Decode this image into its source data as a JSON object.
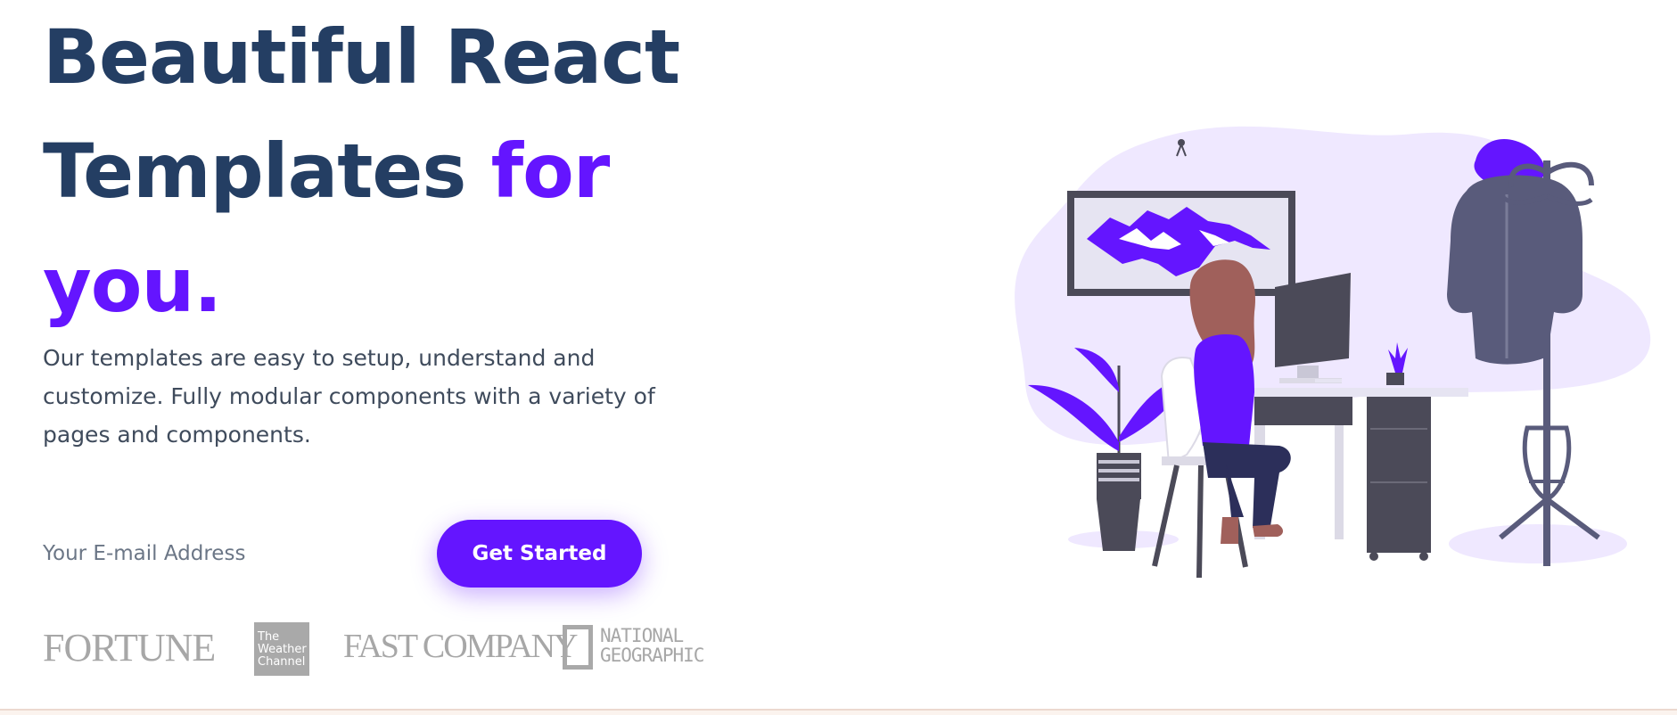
{
  "hero": {
    "headline_line1": "Beautiful React",
    "headline_line2": "Templates",
    "headline_accent2": "for",
    "headline_accent3": "you.",
    "description": "Our templates are easy to setup, understand and customize. Fully modular components with a variety of pages and components.",
    "email_placeholder": "Your E-mail Address",
    "cta_label": "Get Started"
  },
  "logos": {
    "fortune": "FORTUNE",
    "weather_channel": "The Weather Channel",
    "fast_company": "FAST COMPANY",
    "natgeo": "NATIONAL GEOGRAPHIC"
  },
  "colors": {
    "heading": "#243e63",
    "accent": "#6415ff",
    "body_text": "#3f4b5c",
    "logo_gray": "#a7a7a7",
    "illustration_bg": "#efe8ff"
  },
  "icons": [
    "illustration-woman-at-desk"
  ]
}
